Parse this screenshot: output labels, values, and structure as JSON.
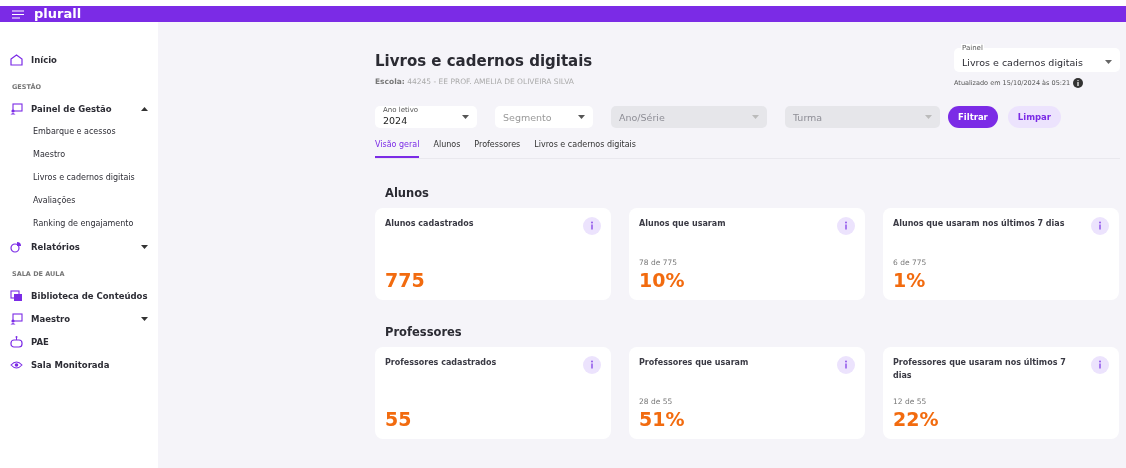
{
  "topbar": {
    "logo": "plurall"
  },
  "sidebar": [
    {
      "kind": "item",
      "label": "Início"
    },
    {
      "kind": "section",
      "label": "GESTÃO"
    },
    {
      "kind": "item",
      "label": "Painel de Gestão",
      "expanded": true,
      "children": [
        {
          "label": "Embarque e acessos"
        },
        {
          "label": "Maestro"
        },
        {
          "label": "Livros e cadernos digitais"
        },
        {
          "label": "Avaliações"
        },
        {
          "label": "Ranking de engajamento"
        }
      ]
    },
    {
      "kind": "item",
      "label": "Relatórios",
      "expanded": false
    },
    {
      "kind": "section",
      "label": "SALA DE AULA"
    },
    {
      "kind": "item",
      "label": "Biblioteca de Conteúdos"
    },
    {
      "kind": "item",
      "label": "Maestro",
      "expanded": false
    },
    {
      "kind": "item",
      "label": "PAE"
    },
    {
      "kind": "item",
      "label": "Sala Monitorada"
    }
  ],
  "header": {
    "title": "Livros e cadernos digitais",
    "school_label": "Escola:",
    "school": "44245 - EE PROF. AMELIA DE OLIVEIRA SILVA",
    "panel_select": {
      "label": "Painel",
      "value": "Livros e cadernos digitais"
    },
    "updated": "Atualizado em 15/10/2024 às 05:21"
  },
  "filters": [
    {
      "label": "Ano letivo",
      "value": "2024",
      "disabled": false
    },
    {
      "placeholder": "Segmento",
      "disabled": false
    },
    {
      "placeholder": "Ano/Série",
      "disabled": true
    },
    {
      "placeholder": "Turma",
      "disabled": true
    }
  ],
  "buttons": [
    {
      "kind": "primary",
      "label": "Filtrar"
    },
    {
      "kind": "secondary",
      "label": "Limpar"
    }
  ],
  "tabs": [
    {
      "label": "Visão geral",
      "selected": true
    },
    {
      "label": "Alunos",
      "selected": false
    },
    {
      "label": "Professores",
      "selected": false
    },
    {
      "label": "Livros e cadernos digitais",
      "selected": false
    }
  ],
  "sections": [
    {
      "title": "Alunos",
      "cards": [
        {
          "title": "Alunos cadastrados",
          "value": "775"
        },
        {
          "title": "Alunos que usaram",
          "detail": "78 de 775",
          "value": "10%"
        },
        {
          "title": "Alunos que usaram nos últimos 7 dias",
          "detail": "6 de 775",
          "value": "1%"
        }
      ]
    },
    {
      "title": "Professores",
      "cards": [
        {
          "title": "Professores cadastrados",
          "value": "55"
        },
        {
          "title": "Professores que usaram",
          "detail": "28 de 55",
          "value": "51%"
        },
        {
          "title": "Professores que usaram nos últimos 7 dias",
          "detail": "12 de 55",
          "value": "22%"
        }
      ]
    }
  ]
}
